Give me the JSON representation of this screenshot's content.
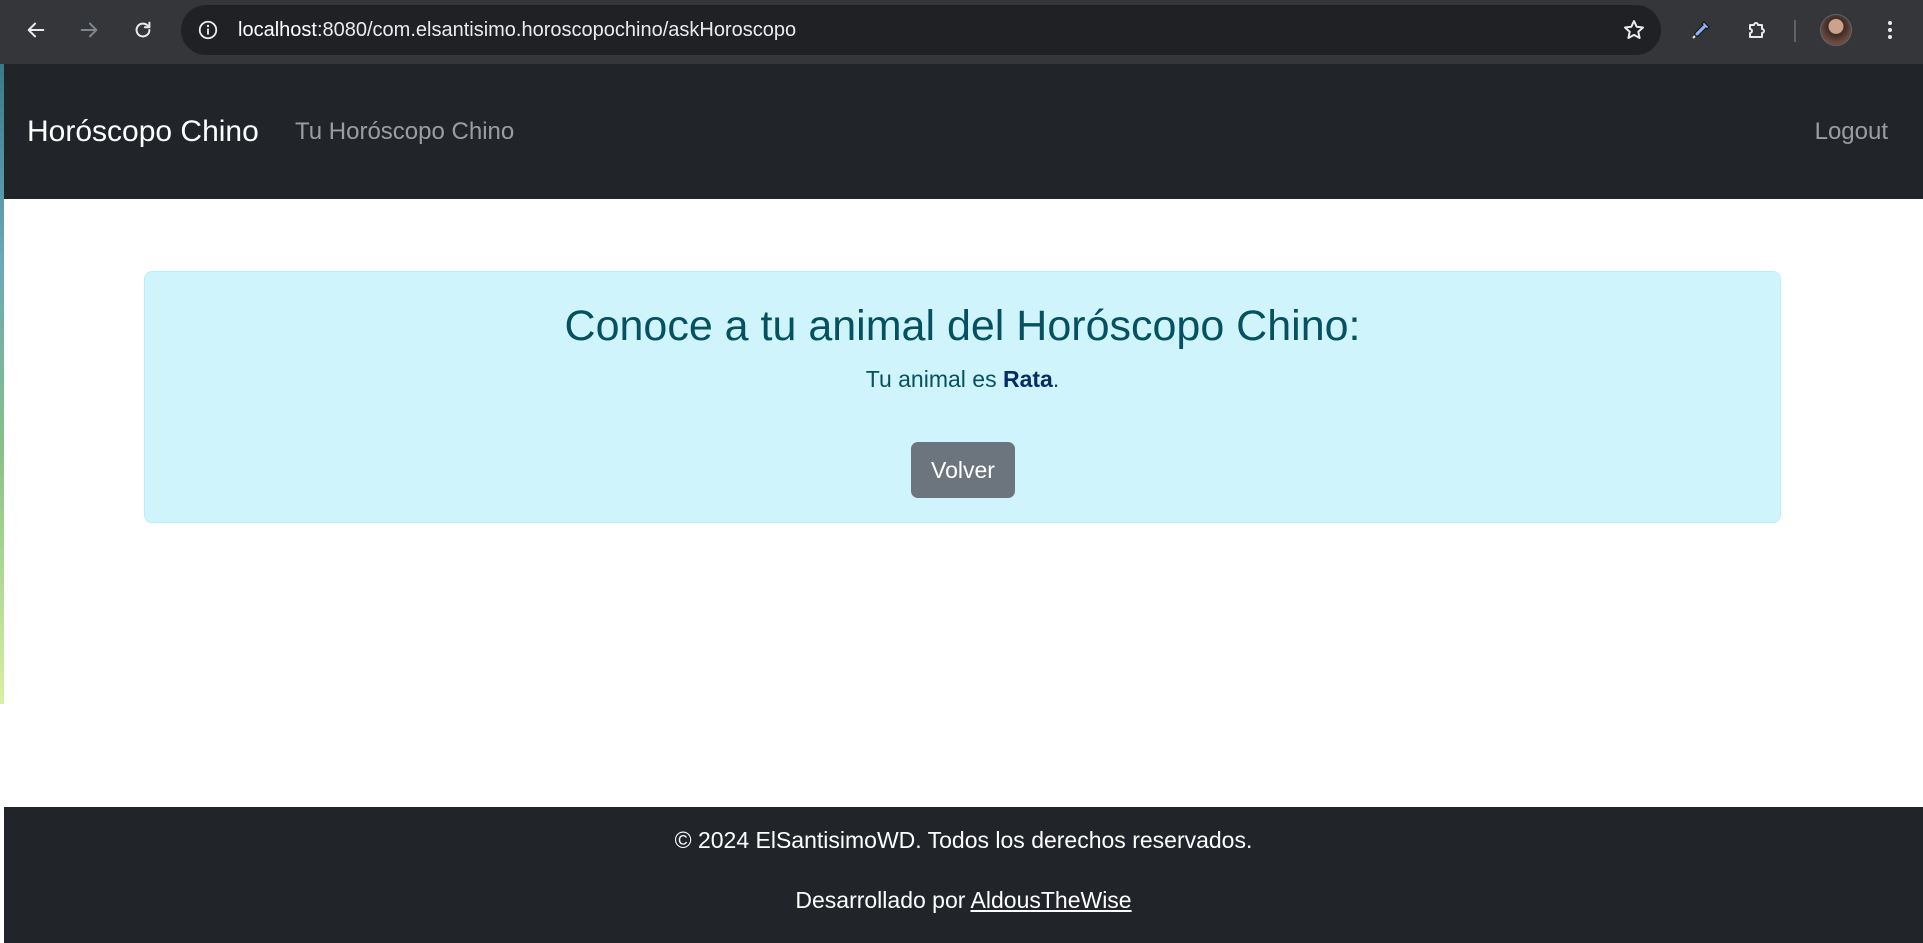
{
  "browser": {
    "url_host": "localhost",
    "url_rest": ":8080/com.elsantisimo.horoscopochino/askHoroscopo",
    "icons": [
      "back-icon",
      "forward-icon",
      "reload-icon",
      "info-icon",
      "star-icon",
      "eyedropper-icon",
      "extensions-icon",
      "avatar",
      "kebab-menu-icon"
    ]
  },
  "navbar": {
    "brand": "Horóscopo Chino",
    "link": "Tu Horóscopo Chino",
    "logout": "Logout"
  },
  "alert": {
    "heading": "Conoce a tu animal del Horóscopo Chino:",
    "result_prefix": "Tu animal es ",
    "animal": "Rata",
    "result_suffix": ".",
    "button": "Volver"
  },
  "footer": {
    "copyright": "© 2024 ElSantisimoWD. Todos los derechos reservados.",
    "developed_prefix": "Desarrollado por ",
    "developer": "AldousTheWise"
  },
  "colors": {
    "navbar_bg": "#212529",
    "alert_bg": "#cff4fc",
    "alert_text": "#055160",
    "button_bg": "#6c757d"
  }
}
